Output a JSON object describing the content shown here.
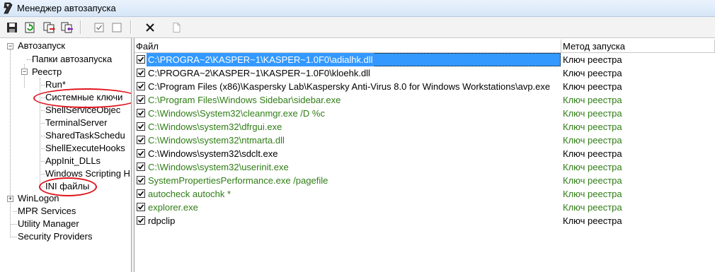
{
  "window": {
    "title": "Менеджер автозапуска"
  },
  "toolbar": {
    "buttons": [
      "save-icon",
      "refresh-icon",
      "export-icon",
      "import-icon",
      "check-icon",
      "uncheck-icon",
      "delete-icon",
      "new-icon"
    ]
  },
  "tree": {
    "root": "Автозапуск",
    "folders": "Папки автозапуска",
    "registry": "Реестр",
    "registry_children": [
      "Run*",
      "Системные ключи",
      "ShellServiceObjec",
      "TerminalServer",
      "SharedTaskSchedu",
      "ShellExecuteHooks",
      "AppInit_DLLs",
      "Windows Scripting H",
      "INI файлы"
    ],
    "winlogon": "WinLogon",
    "mpr": "MPR Services",
    "utility": "Utility Manager",
    "security": "Security Providers"
  },
  "list": {
    "columns": {
      "file": "Файл",
      "method": "Метод запуска"
    },
    "rows": [
      {
        "file": "C:\\PROGRA~2\\KASPER~1\\KASPER~1.0F0\\adialhk.dll",
        "method": "Ключ реестра",
        "checked": true,
        "green": false,
        "selected": true
      },
      {
        "file": "C:\\PROGRA~2\\KASPER~1\\KASPER~1.0F0\\kloehk.dll",
        "method": "Ключ реестра",
        "checked": true,
        "green": false
      },
      {
        "file": "C:\\Program Files (x86)\\Kaspersky Lab\\Kaspersky Anti-Virus 8.0 for Windows Workstations\\avp.exe",
        "method": "Ключ реестра",
        "checked": true,
        "green": false
      },
      {
        "file": "C:\\Program Files\\Windows Sidebar\\sidebar.exe",
        "method": "Ключ реестра",
        "checked": true,
        "green": true
      },
      {
        "file": "C:\\Windows\\System32\\cleanmgr.exe /D %c",
        "method": "Ключ реестра",
        "checked": true,
        "green": true
      },
      {
        "file": "C:\\Windows\\system32\\dfrgui.exe",
        "method": "Ключ реестра",
        "checked": true,
        "green": true
      },
      {
        "file": "C:\\Windows\\system32\\ntmarta.dll",
        "method": "Ключ реестра",
        "checked": true,
        "green": true
      },
      {
        "file": "C:\\Windows\\system32\\sdclt.exe",
        "method": "Ключ реестра",
        "checked": true,
        "green": false
      },
      {
        "file": "C:\\Windows\\system32\\userinit.exe",
        "method": "Ключ реестра",
        "checked": true,
        "green": true
      },
      {
        "file": "SystemPropertiesPerformance.exe /pagefile",
        "method": "Ключ реестра",
        "checked": true,
        "green": true
      },
      {
        "file": "autocheck autochk *",
        "method": "Ключ реестра",
        "checked": true,
        "green": true
      },
      {
        "file": "explorer.exe",
        "method": "Ключ реестра",
        "checked": true,
        "green": true
      },
      {
        "file": "rdpclip",
        "method": "Ключ реестра",
        "checked": true,
        "green": false
      }
    ]
  },
  "colors": {
    "accent": "#3399ff",
    "microsoft_green": "#2e7d14",
    "annotation_red": "#e0141e"
  }
}
